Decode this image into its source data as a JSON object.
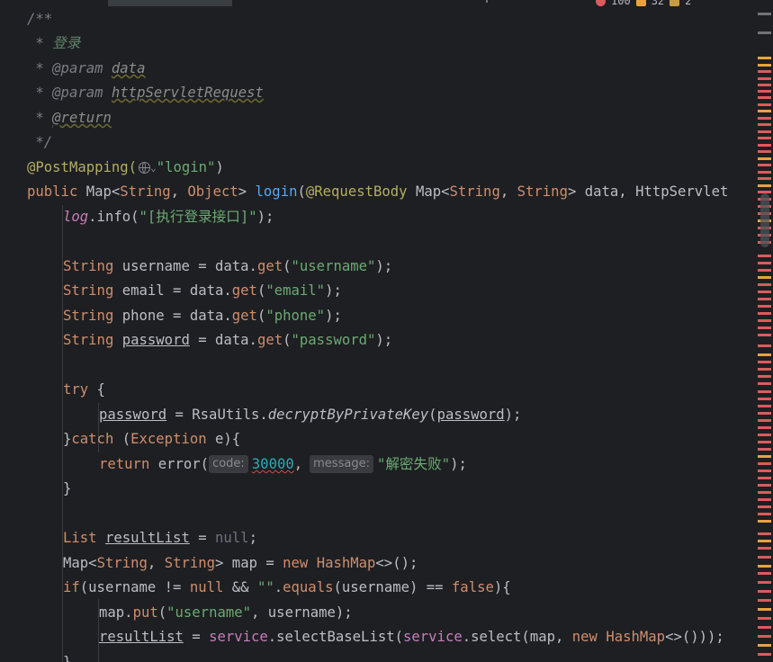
{
  "tabs": {
    "active_dot": "·"
  },
  "inspections": {
    "errors": "100",
    "warnings": "32",
    "weak_warnings": "2"
  },
  "hints": {
    "code": "code:",
    "message": "message:"
  },
  "code": {
    "l1": "/**",
    "l2_star": " * ",
    "l2_text": "登录",
    "l3_star": " * ",
    "l3_tag": "@param",
    "l3_ref": "data",
    "l4_star": " * ",
    "l4_tag": "@param",
    "l4_ref": "httpServletRequest",
    "l5_star": " * ",
    "l5_tag": "@return",
    "l6": " */",
    "l7_ann": "@PostMapping(",
    "l7_str": "\"login\"",
    "l7_end": ")",
    "l8_a": "public ",
    "l8_b": "Map<",
    "l8_c": "String",
    "l8_d": ", ",
    "l8_e": "Object",
    "l8_f": "> ",
    "l8_g": "login",
    "l8_h": "(",
    "l8_i": "@RequestBody ",
    "l8_j": "Map<",
    "l8_k": "String",
    "l8_l": ", ",
    "l8_m": "String",
    "l8_n": "> data, HttpServlet",
    "l9_a": "log",
    "l9_b": ".info(",
    "l9_c": "\"[执行登录接口]\"",
    "l9_d": ");",
    "l11_t": "String",
    "l11_v": " username = data.",
    "l11_f": "get",
    "l11_s": "\"username\"",
    "l12_t": "String",
    "l12_v": " email = data.",
    "l12_f": "get",
    "l12_s": "\"email\"",
    "l13_t": "String",
    "l13_v": " phone = data.",
    "l13_f": "get",
    "l13_s": "\"phone\"",
    "l14_t": "String",
    "l14_v": "password",
    "l14_r": " = data.",
    "l14_f": "get",
    "l14_s": "\"password\"",
    "l16_k": "try",
    "l16_r": " {",
    "l17_v": "password",
    "l17_a": " = RsaUtils.",
    "l17_m": "decryptByPrivateKey",
    "l17_b": "(",
    "l17_p": "password",
    "l17_c": ");",
    "l18_a": "}",
    "l18_k": "catch",
    "l18_b": " (",
    "l18_t": "Exception",
    "l18_c": " e){",
    "l19_k": "return",
    "l19_a": " error(",
    "l19_n": "30000",
    "l19_b": ",",
    "l19_s": "\"解密失败\"",
    "l19_c": ");",
    "l20": "}",
    "l22_t": "List",
    "l22_sp": " ",
    "l22_v": "resultList",
    "l22_a": " = ",
    "l22_n": "null",
    "l22_b": ";",
    "l23_a": "Map<",
    "l23_t1": "String",
    "l23_b": ", ",
    "l23_t2": "String",
    "l23_c": "> map = ",
    "l23_k": "new",
    "l23_d": " ",
    "l23_h": "HashMap",
    "l23_e": "<>();",
    "l24_k": "if",
    "l24_a": "(username != ",
    "l24_n": "null",
    "l24_b": " && ",
    "l24_s": "\"\"",
    "l24_c": ".",
    "l24_f": "equals",
    "l24_d": "(username) == ",
    "l24_f2": "false",
    "l24_e": "){",
    "l25_a": "map.",
    "l25_f": "put",
    "l25_b": "(",
    "l25_s": "\"username\"",
    "l25_c": ", username);",
    "l26_v": "resultList",
    "l26_a": " = ",
    "l26_f1": "service",
    "l26_b": ".selectBaseList(",
    "l26_f2": "service",
    "l26_c": ".select(map, ",
    "l26_k": "new",
    "l26_d": " ",
    "l26_h": "HashMap",
    "l26_e": "<>()));",
    "l27": "}"
  },
  "colors": {
    "background": "#1e1f22",
    "keyword": "#cf8e6d",
    "string": "#6aab73",
    "number": "#2aacb8",
    "annotation": "#b3ae60",
    "field": "#c77dbb",
    "function": "#56a8f5",
    "error_mark": "#db5c5c",
    "warning_mark": "#e8a33d"
  }
}
